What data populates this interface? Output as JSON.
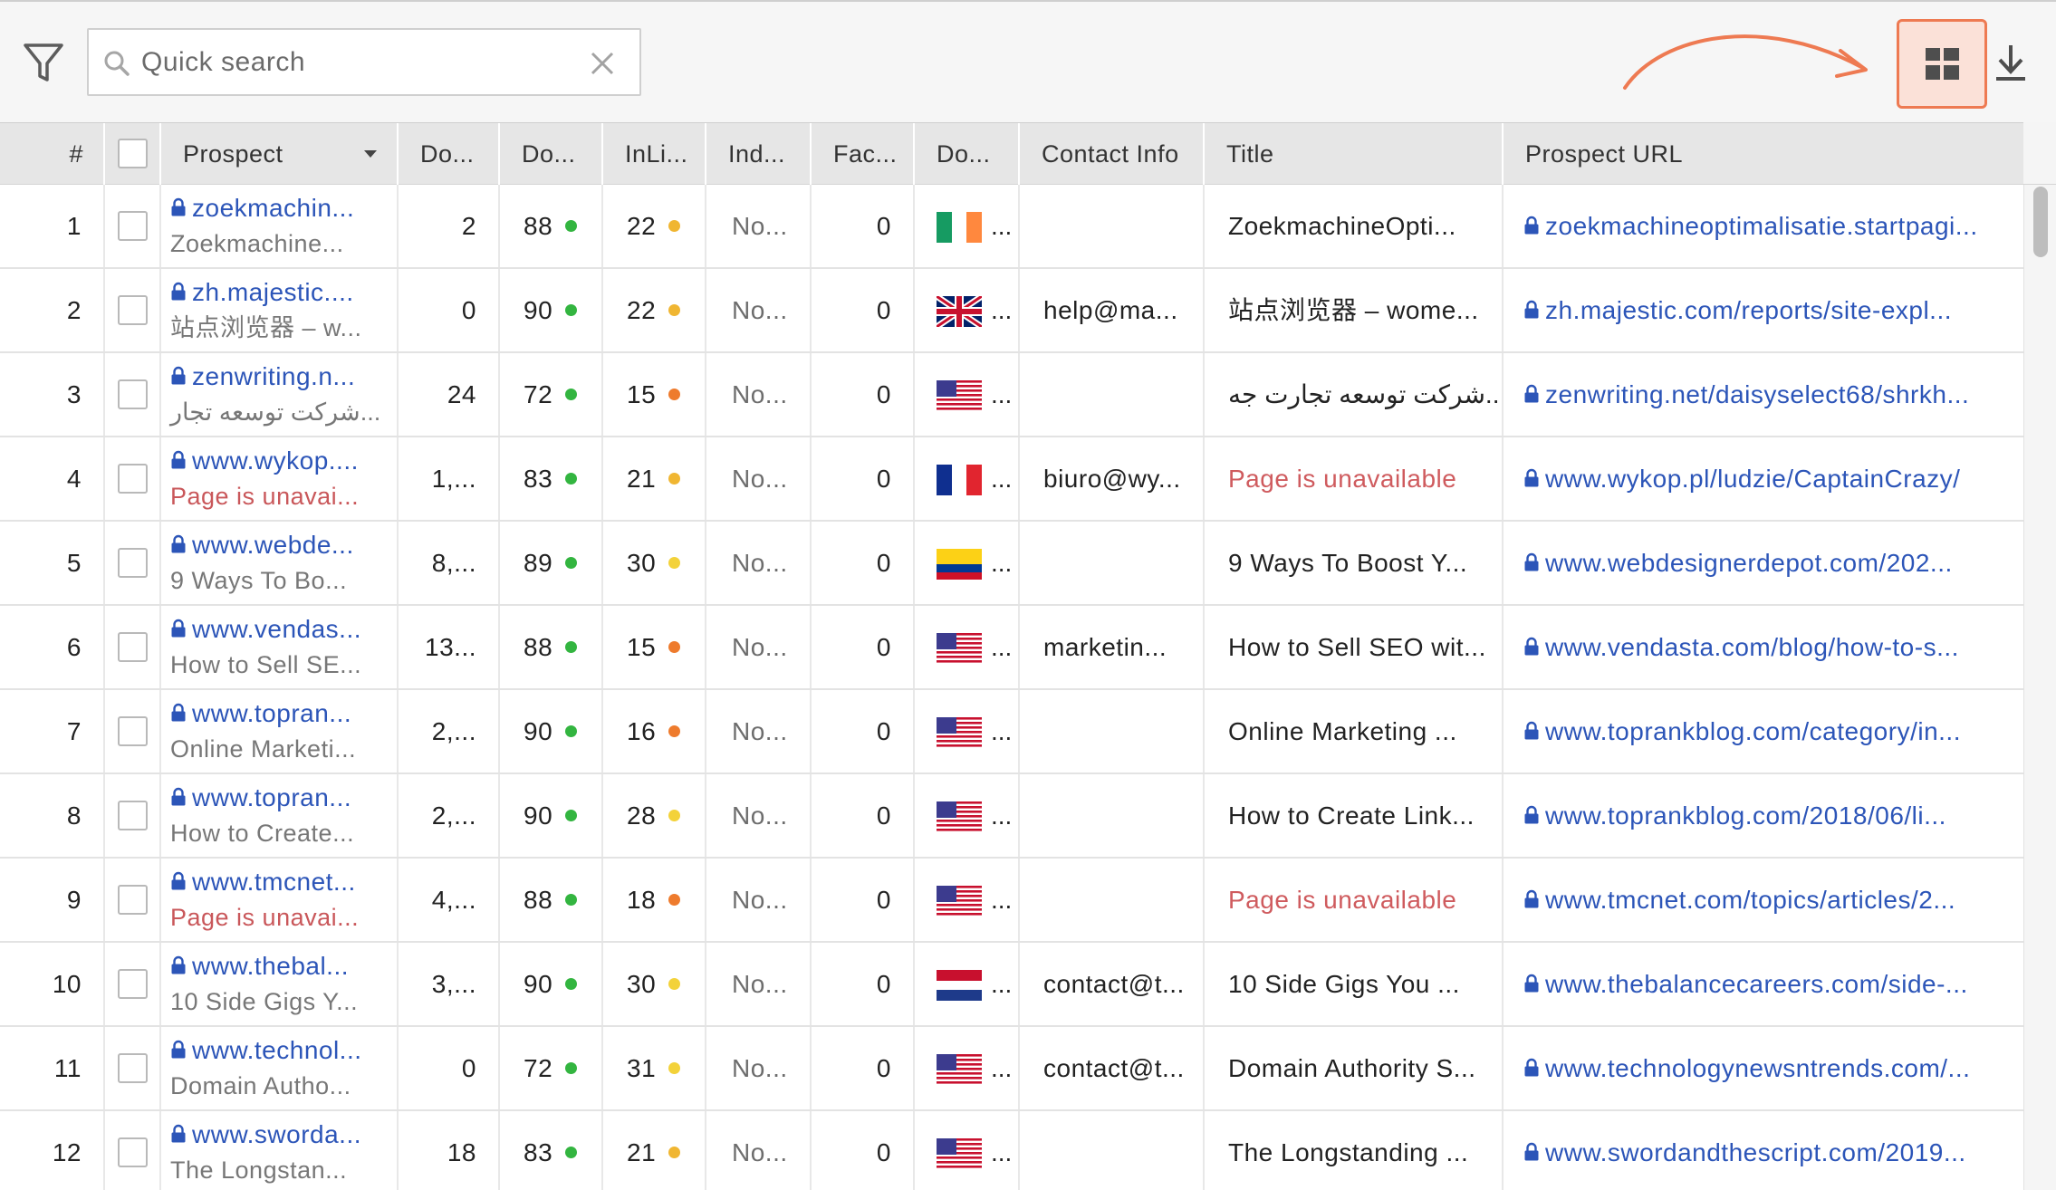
{
  "toolbar": {
    "search_placeholder": "Quick search",
    "accent_color": "#ee7a52",
    "icons": [
      "filter-icon",
      "search-icon",
      "clear-icon",
      "arrow-annotation",
      "grid-layout-icon",
      "download-icon"
    ]
  },
  "columns": {
    "num": "#",
    "prospect": "Prospect",
    "do1": "Do...",
    "do2": "Do...",
    "inli": "InLi...",
    "ind": "Ind...",
    "fac": "Fac...",
    "do3": "Do...",
    "contact": "Contact Info",
    "title": "Title",
    "url": "Prospect URL"
  },
  "rows": [
    {
      "num": "1",
      "domain": "zoekmachin...",
      "sub": "Zoekmachine...",
      "sub_error": false,
      "do1": "2",
      "do2": "88",
      "do2_color": "#33b540",
      "inli": "22",
      "inli_color": "#f0b632",
      "ind": "No...",
      "fac": "0",
      "flag": "ie",
      "more": "...",
      "contact": "",
      "title": "ZoekmachineOpti...",
      "title_error": false,
      "url": "zoekmachineoptimalisatie.startpagi..."
    },
    {
      "num": "2",
      "domain": "zh.majestic....",
      "sub": "站点浏览器 – w...",
      "sub_error": false,
      "do1": "0",
      "do2": "90",
      "do2_color": "#33b540",
      "inli": "22",
      "inli_color": "#f0b632",
      "ind": "No...",
      "fac": "0",
      "flag": "gb",
      "more": "...",
      "contact": "help@ma...",
      "title": "站点浏览器 – wome...",
      "title_error": false,
      "url": "zh.majestic.com/reports/site-expl..."
    },
    {
      "num": "3",
      "domain": "zenwriting.n...",
      "sub": "شرکت توسعه تجار...",
      "sub_error": false,
      "do1": "24",
      "do2": "72",
      "do2_color": "#33b540",
      "inli": "15",
      "inli_color": "#ee7b2d",
      "ind": "No...",
      "fac": "0",
      "flag": "us",
      "more": "...",
      "contact": "",
      "title": "شرکت توسعه تجارت جه...",
      "title_error": false,
      "url": "zenwriting.net/daisyselect68/shrkh..."
    },
    {
      "num": "4",
      "domain": "www.wykop....",
      "sub": "Page is unavai...",
      "sub_error": true,
      "do1": "1,...",
      "do2": "83",
      "do2_color": "#33b540",
      "inli": "21",
      "inli_color": "#f0b632",
      "ind": "No...",
      "fac": "0",
      "flag": "fr",
      "more": "...",
      "contact": "biuro@wy...",
      "title": "Page is unavailable",
      "title_error": true,
      "url": "www.wykop.pl/ludzie/CaptainCrazy/"
    },
    {
      "num": "5",
      "domain": "www.webde...",
      "sub": "9 Ways To Bo...",
      "sub_error": false,
      "do1": "8,...",
      "do2": "89",
      "do2_color": "#33b540",
      "inli": "30",
      "inli_color": "#f3d23a",
      "ind": "No...",
      "fac": "0",
      "flag": "co",
      "more": "...",
      "contact": "",
      "title": "9 Ways To Boost Y...",
      "title_error": false,
      "url": "www.webdesignerdepot.com/202..."
    },
    {
      "num": "6",
      "domain": "www.vendas...",
      "sub": "How to Sell SE...",
      "sub_error": false,
      "do1": "13...",
      "do2": "88",
      "do2_color": "#33b540",
      "inli": "15",
      "inli_color": "#ee7b2d",
      "ind": "No...",
      "fac": "0",
      "flag": "us",
      "more": "...",
      "contact": "marketin...",
      "title": "How to Sell SEO wit...",
      "title_error": false,
      "url": "www.vendasta.com/blog/how-to-s..."
    },
    {
      "num": "7",
      "domain": "www.topran...",
      "sub": "Online Marketi...",
      "sub_error": false,
      "do1": "2,...",
      "do2": "90",
      "do2_color": "#33b540",
      "inli": "16",
      "inli_color": "#ee7b2d",
      "ind": "No...",
      "fac": "0",
      "flag": "us",
      "more": "...",
      "contact": "",
      "title": "Online Marketing ...",
      "title_error": false,
      "url": "www.toprankblog.com/category/in..."
    },
    {
      "num": "8",
      "domain": "www.topran...",
      "sub": "How to Create...",
      "sub_error": false,
      "do1": "2,...",
      "do2": "90",
      "do2_color": "#33b540",
      "inli": "28",
      "inli_color": "#f3d23a",
      "ind": "No...",
      "fac": "0",
      "flag": "us",
      "more": "...",
      "contact": "",
      "title": "How to Create Link...",
      "title_error": false,
      "url": "www.toprankblog.com/2018/06/li..."
    },
    {
      "num": "9",
      "domain": "www.tmcnet...",
      "sub": "Page is unavai...",
      "sub_error": true,
      "do1": "4,...",
      "do2": "88",
      "do2_color": "#33b540",
      "inli": "18",
      "inli_color": "#ee7b2d",
      "ind": "No...",
      "fac": "0",
      "flag": "us",
      "more": "...",
      "contact": "",
      "title": "Page is unavailable",
      "title_error": true,
      "url": "www.tmcnet.com/topics/articles/2..."
    },
    {
      "num": "10",
      "domain": "www.thebal...",
      "sub": "10 Side Gigs Y...",
      "sub_error": false,
      "do1": "3,...",
      "do2": "90",
      "do2_color": "#33b540",
      "inli": "30",
      "inli_color": "#f3d23a",
      "ind": "No...",
      "fac": "0",
      "flag": "nl",
      "more": "...",
      "contact": "contact@t...",
      "title": "10 Side Gigs You ...",
      "title_error": false,
      "url": "www.thebalancecareers.com/side-..."
    },
    {
      "num": "11",
      "domain": "www.technol...",
      "sub": "Domain Autho...",
      "sub_error": false,
      "do1": "0",
      "do2": "72",
      "do2_color": "#33b540",
      "inli": "31",
      "inli_color": "#f3d23a",
      "ind": "No...",
      "fac": "0",
      "flag": "us",
      "more": "...",
      "contact": "contact@t...",
      "title": "Domain Authority S...",
      "title_error": false,
      "url": "www.technologynewsntrends.com/..."
    },
    {
      "num": "12",
      "domain": "www.sworda...",
      "sub": "The Longstan...",
      "sub_error": false,
      "do1": "18",
      "do2": "83",
      "do2_color": "#33b540",
      "inli": "21",
      "inli_color": "#f0b632",
      "ind": "No...",
      "fac": "0",
      "flag": "us",
      "more": "...",
      "contact": "",
      "title": "The Longstanding ...",
      "title_error": false,
      "url": "www.swordandthescript.com/2019..."
    }
  ]
}
